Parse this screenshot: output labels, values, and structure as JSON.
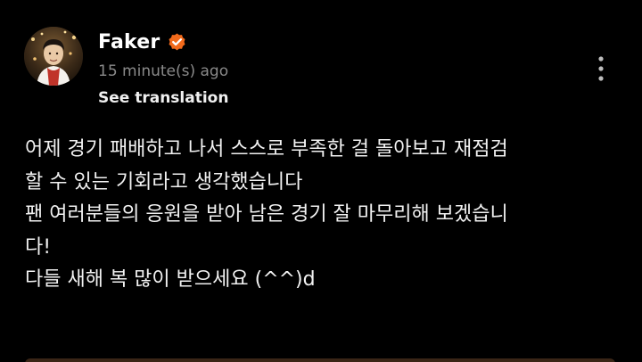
{
  "post": {
    "author": "Faker",
    "verified": true,
    "timestamp": "15 minute(s) ago",
    "translate_label": "See translation",
    "body_lines": [
      "어제 경기 패배하고 나서 스스로 부족한 걸 돌아보고 재점검",
      "할 수 있는 기회라고 생각했습니다",
      "팬 여러분들의 응원을 받아 남은 경기 잘 마무리해 보겠습니",
      "다!",
      "다들 새해 복 많이 받으세요 (^^)d"
    ]
  },
  "icons": {
    "avatar": "avatar-photo",
    "verified": "verified-badge-icon",
    "more": "more-vertical-icon"
  },
  "colors": {
    "background": "#000000",
    "text_primary": "#ffffff",
    "text_secondary": "#8a8a8a",
    "verified_badge": "#f26a1b",
    "bottom_strip": "#3a2516"
  }
}
